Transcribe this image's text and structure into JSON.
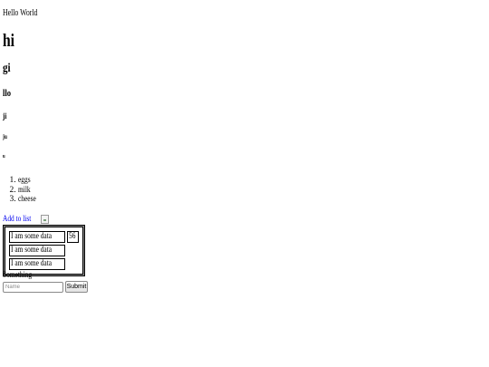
{
  "greeting": "Hello World",
  "headings": {
    "h1": "hi",
    "h2": "gi",
    "h3": "llo",
    "h4": "ji",
    "h5": "ju",
    "h6": "u"
  },
  "list": {
    "items": [
      "eggs",
      "milk",
      "cheese"
    ]
  },
  "actions": {
    "add_to_list": "Add to list"
  },
  "table": {
    "rows": [
      [
        "I am some data",
        "56"
      ],
      [
        "I am some data"
      ],
      [
        "I am some data"
      ]
    ]
  },
  "form": {
    "label": "Something",
    "name_placeholder": "Name",
    "submit_label": "Submit"
  }
}
